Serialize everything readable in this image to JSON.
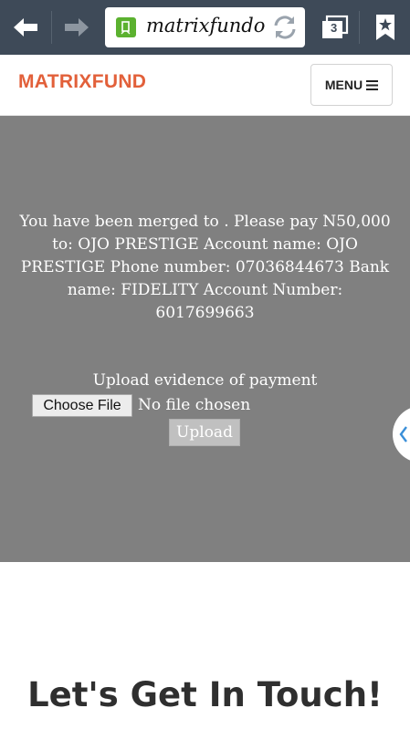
{
  "browser": {
    "url": "matrixfundo",
    "icons": {
      "back": "arrow-left-icon",
      "forward": "arrow-right-icon",
      "reload": "reload-icon",
      "tabs": "tabs-icon",
      "bookmark": "bookmark-star-icon"
    },
    "tab_count": "3"
  },
  "header": {
    "brand": "MATRIXFUND",
    "menu_label": "MENU",
    "brand_color": "#e2603a"
  },
  "merge": {
    "message": "You have been merged to . Please pay N50,000 to: OJO PRESTIGE Account name: OJO PRESTIGE Phone number: 07036844673 Bank name: FIDELITY Account Number: 6017699663",
    "upload_label": "Upload evidence of payment",
    "choose_file_label": "Choose File",
    "file_status": "No file chosen",
    "upload_button": "Upload",
    "background_color": "#808080"
  },
  "contact": {
    "title": "Let's Get In Touch!"
  }
}
